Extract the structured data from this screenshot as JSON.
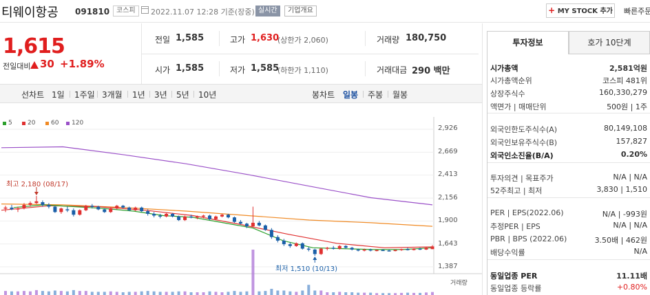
{
  "header": {
    "company_name": "티웨이항공",
    "code": "091810",
    "market": "코스피",
    "date": "2022.11.07 12:28  기준(장중)",
    "realtime": "실시간",
    "overview": "기업개요",
    "mystock_label": "MY STOCK 추가",
    "quick_link": "빠른주문"
  },
  "price": {
    "current": "1,615",
    "vs_label": "전일대비",
    "change": "30",
    "change_pct": "+1.89%"
  },
  "summary": {
    "prev_close_label": "전일",
    "prev_close": "1,585",
    "high_label": "고가",
    "high": "1,630",
    "upper_limit": "(상한가 2,060)",
    "volume_label": "거래량",
    "volume": "180,750",
    "open_label": "시가",
    "open": "1,585",
    "low_label": "저가",
    "low": "1,585",
    "lower_limit": "(하한가 1,110)",
    "amount_label": "거래대금",
    "amount": "290 백만"
  },
  "period_bar": {
    "line_chart_label": "선차트",
    "line_items": [
      "1일",
      "1주일",
      "3개월",
      "1년",
      "3년",
      "5년",
      "10년"
    ],
    "candle_label": "봉차트",
    "candle_items": [
      "일봉",
      "주봉",
      "월봉"
    ],
    "selected": "일봉"
  },
  "chart": {
    "legend": [
      {
        "name": "5",
        "color": "#2ca02c"
      },
      {
        "name": "20",
        "color": "#e03030"
      },
      {
        "name": "60",
        "color": "#f08a24"
      },
      {
        "name": "120",
        "color": "#9a50c8"
      }
    ],
    "y_ticks": [
      "2,926",
      "2,669",
      "2,413",
      "2,156",
      "1,900",
      "1,643",
      "1,387"
    ],
    "high_annotation": "최고 2,180 (08/17)",
    "low_annotation": "최저 1,510 (10/13)",
    "volume_label": "거래량"
  },
  "right_panel": {
    "tab_invest": "투자정보",
    "tab_quote": "호가 10단계",
    "rows": [
      {
        "label": "시가총액",
        "value": "2,581억원",
        "bold": true
      },
      {
        "label": "시가총액순위",
        "value": "코스피 481위"
      },
      {
        "label": "상장주식수",
        "value": "160,330,279"
      },
      {
        "label": "액면가 | 매매단위",
        "value": "500원 | 1주"
      },
      {
        "label": "외국인한도주식수(A)",
        "value": "80,149,108"
      },
      {
        "label": "외국인보유주식수(B)",
        "value": "157,827"
      },
      {
        "label": "외국인소진율(B/A)",
        "value": "0.20%",
        "bold": true
      },
      {
        "label": "투자의견 | 목표주가",
        "value": "N/A | N/A"
      },
      {
        "label": "52주최고 | 최저",
        "value": "3,830 | 1,510"
      },
      {
        "label": "PER | EPS(2022.06)",
        "value": "N/A | -993원"
      },
      {
        "label": "추정PER | EPS",
        "value": "N/A | N/A"
      },
      {
        "label": "PBR | BPS (2022.06)",
        "value": "3.50배 | 462원"
      },
      {
        "label": "배당수익률",
        "value": "N/A"
      },
      {
        "label": "동일업종 PER",
        "value": "11.11배",
        "bold": true
      },
      {
        "label": "동일업종 등락률",
        "value": "+0.80%",
        "red": true
      }
    ]
  },
  "chart_data": {
    "type": "candlestick",
    "ylim": [
      1387,
      2926
    ],
    "y_ticks": [
      2926,
      2669,
      2413,
      2156,
      1900,
      1643,
      1387
    ],
    "candles": [
      [
        2040,
        2070,
        2000,
        2050
      ],
      [
        2050,
        2080,
        2020,
        2030
      ],
      [
        2030,
        2060,
        2000,
        2040
      ],
      [
        2040,
        2100,
        2030,
        2080
      ],
      [
        2080,
        2120,
        2060,
        2100
      ],
      [
        2100,
        2180,
        2090,
        2120
      ],
      [
        2110,
        2130,
        2060,
        2080
      ],
      [
        2080,
        2100,
        2040,
        2060
      ],
      [
        2060,
        2070,
        1990,
        2000
      ],
      [
        2000,
        2050,
        1980,
        2040
      ],
      [
        2030,
        2060,
        2000,
        2020
      ],
      [
        2020,
        2040,
        1950,
        1970
      ],
      [
        1970,
        2030,
        1960,
        2020
      ],
      [
        2020,
        2080,
        2010,
        2070
      ],
      [
        2070,
        2090,
        2040,
        2060
      ],
      [
        2060,
        2070,
        2020,
        2030
      ],
      [
        2030,
        2040,
        1990,
        2000
      ],
      [
        2000,
        2050,
        1990,
        2040
      ],
      [
        2040,
        2080,
        2030,
        2070
      ],
      [
        2070,
        2080,
        2040,
        2050
      ],
      [
        2050,
        2060,
        2010,
        2020
      ],
      [
        2020,
        2060,
        2010,
        2050
      ],
      [
        2050,
        2060,
        2000,
        2010
      ],
      [
        2010,
        2030,
        1960,
        1980
      ],
      [
        1980,
        2000,
        1940,
        1960
      ],
      [
        1960,
        1980,
        1930,
        1950
      ],
      [
        1950,
        1990,
        1940,
        1980
      ],
      [
        1980,
        1990,
        1940,
        1950
      ],
      [
        1950,
        1960,
        1900,
        1910
      ],
      [
        1910,
        1960,
        1900,
        1950
      ],
      [
        1950,
        1970,
        1930,
        1940
      ],
      [
        1940,
        1960,
        1920,
        1950
      ],
      [
        1950,
        1970,
        1930,
        1960
      ],
      [
        1960,
        1970,
        1910,
        1920
      ],
      [
        1920,
        1960,
        1910,
        1950
      ],
      [
        1950,
        1980,
        1940,
        1970
      ],
      [
        1970,
        1980,
        1930,
        1940
      ],
      [
        1940,
        1950,
        1880,
        1890
      ],
      [
        1890,
        1910,
        1860,
        1870
      ],
      [
        1870,
        1880,
        1820,
        1840
      ],
      [
        1840,
        2060,
        1830,
        1880
      ],
      [
        1880,
        1900,
        1840,
        1850
      ],
      [
        1850,
        1860,
        1790,
        1800
      ],
      [
        1800,
        1820,
        1700,
        1720
      ],
      [
        1720,
        1740,
        1660,
        1680
      ],
      [
        1680,
        1700,
        1620,
        1640
      ],
      [
        1640,
        1660,
        1600,
        1620
      ],
      [
        1620,
        1660,
        1610,
        1650
      ],
      [
        1650,
        1660,
        1580,
        1590
      ],
      [
        1590,
        1610,
        1560,
        1580
      ],
      [
        1580,
        1590,
        1510,
        1530
      ],
      [
        1530,
        1600,
        1520,
        1590
      ],
      [
        1590,
        1610,
        1570,
        1600
      ],
      [
        1600,
        1620,
        1580,
        1590
      ],
      [
        1590,
        1630,
        1580,
        1620
      ],
      [
        1620,
        1630,
        1590,
        1600
      ],
      [
        1600,
        1610,
        1570,
        1580
      ],
      [
        1580,
        1590,
        1560,
        1570
      ],
      [
        1570,
        1590,
        1560,
        1580
      ],
      [
        1580,
        1590,
        1560,
        1570
      ],
      [
        1570,
        1580,
        1560,
        1575
      ],
      [
        1575,
        1585,
        1565,
        1570
      ],
      [
        1570,
        1580,
        1560,
        1565
      ],
      [
        1565,
        1580,
        1560,
        1575
      ],
      [
        1575,
        1590,
        1565,
        1585
      ],
      [
        1585,
        1600,
        1570,
        1575
      ],
      [
        1575,
        1595,
        1570,
        1590
      ],
      [
        1590,
        1600,
        1575,
        1580
      ],
      [
        1580,
        1610,
        1575,
        1600
      ],
      [
        1585,
        1630,
        1585,
        1615
      ]
    ],
    "ma120": [
      2720,
      2730,
      2640,
      2540,
      2420,
      2290,
      2160,
      2080
    ],
    "ma60": [
      2090,
      2080,
      2050,
      2010,
      1960,
      1910,
      1880,
      1840
    ],
    "ma20": [
      2020,
      2070,
      2060,
      2020,
      1960,
      1860,
      1750,
      1650,
      1600,
      1610
    ],
    "ma5": [
      2050,
      2080,
      2060,
      2040,
      2010,
      1960,
      1940,
      1880,
      1820,
      1680,
      1600,
      1590,
      1580,
      1580,
      1600
    ]
  }
}
